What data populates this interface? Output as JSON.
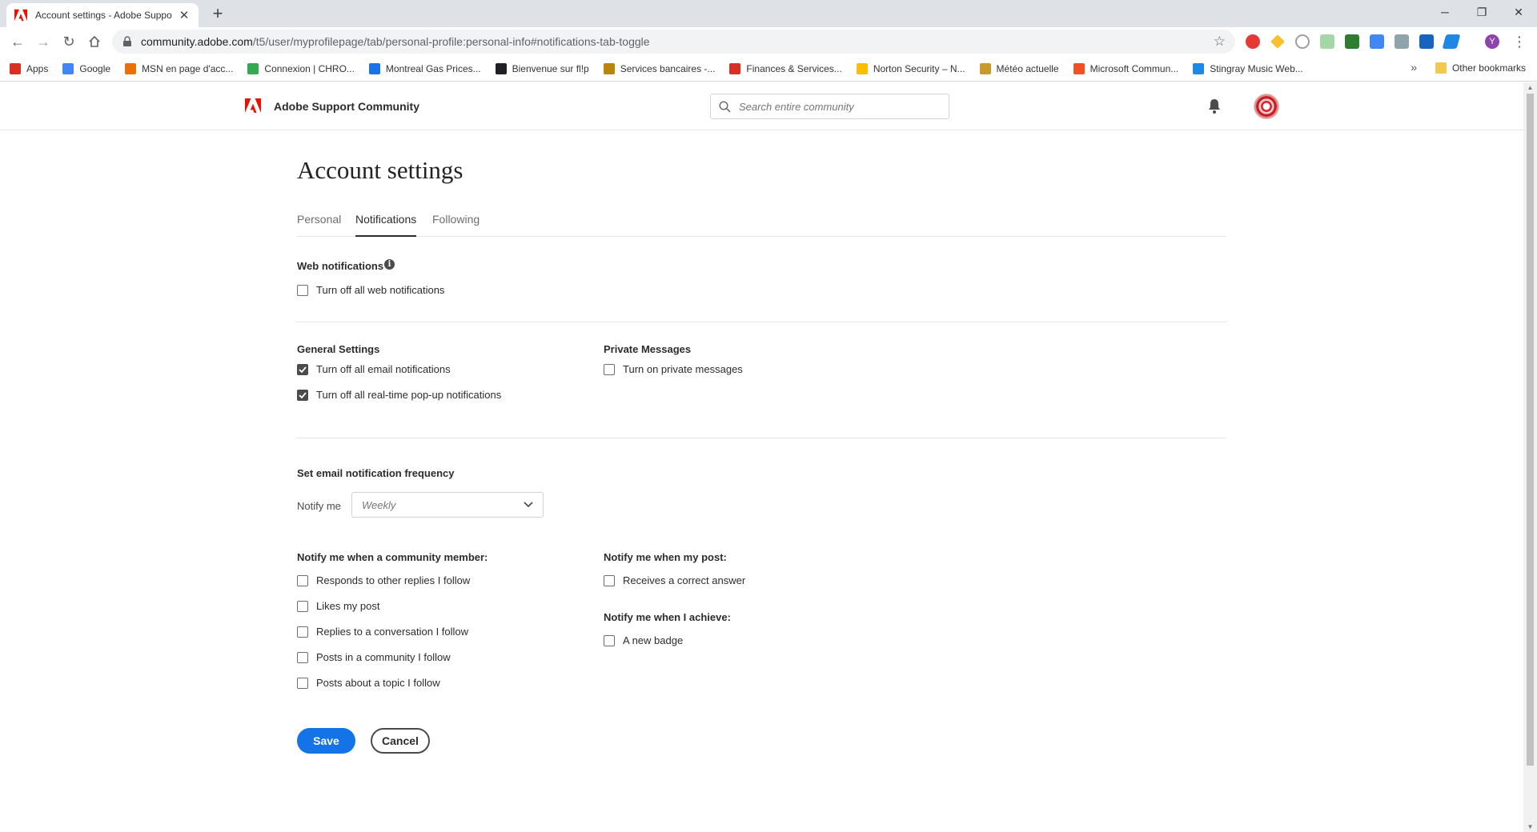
{
  "browser": {
    "tab_title": "Account settings - Adobe Suppo",
    "url_host": "community.adobe.com",
    "url_path": "/t5/user/myprofilepage/tab/personal-profile:personal-info#notifications-tab-toggle",
    "profile_initial": "Y",
    "bookmarks": [
      {
        "label": "Apps",
        "icon": "apps-grid-icon",
        "color": "#d93025"
      },
      {
        "label": "Google",
        "icon": "google-icon",
        "color": "#4285f4"
      },
      {
        "label": "MSN en page d'acc...",
        "icon": "msn-icon",
        "color": "#e8710a"
      },
      {
        "label": "Connexion | CHRO...",
        "icon": "chrono-icon",
        "color": "#34a853"
      },
      {
        "label": "Montreal Gas Prices...",
        "icon": "gasbuddy-icon",
        "color": "#1a73e8"
      },
      {
        "label": "Bienvenue sur fl!p",
        "icon": "flip-icon",
        "color": "#202124"
      },
      {
        "label": "Services bancaires -...",
        "icon": "bank-icon",
        "color": "#b8860b"
      },
      {
        "label": "Finances & Services...",
        "icon": "finance-icon",
        "color": "#d93025"
      },
      {
        "label": "Norton Security – N...",
        "icon": "norton-icon",
        "color": "#fbbc04"
      },
      {
        "label": "Météo actuelle",
        "icon": "weather-icon",
        "color": "#c99a2e"
      },
      {
        "label": "Microsoft Commun...",
        "icon": "microsoft-icon",
        "color": "#f25022"
      },
      {
        "label": "Stingray Music Web...",
        "icon": "stingray-icon",
        "color": "#1e88e5"
      }
    ],
    "other_bookmarks": "Other bookmarks"
  },
  "header": {
    "site_name": "Adobe Support Community",
    "search_placeholder": "Search entire community"
  },
  "page": {
    "title": "Account settings",
    "tabs": [
      {
        "label": "Personal",
        "active": false
      },
      {
        "label": "Notifications",
        "active": true
      },
      {
        "label": "Following",
        "active": false
      }
    ]
  },
  "web_notifications": {
    "title": "Web notifications",
    "info_glyph": "i",
    "items": [
      {
        "label": "Turn off all web notifications",
        "checked": false
      }
    ]
  },
  "general_settings": {
    "title": "General Settings",
    "items": [
      {
        "label": "Turn off all email notifications",
        "checked": true
      },
      {
        "label": "Turn off all real-time pop-up notifications",
        "checked": true
      }
    ]
  },
  "private_messages": {
    "title": "Private Messages",
    "items": [
      {
        "label": "Turn on private messages",
        "checked": false
      }
    ]
  },
  "email_frequency": {
    "title": "Set email notification frequency",
    "notify_label": "Notify me",
    "selected": "Weekly"
  },
  "community_member": {
    "title": "Notify me when a community member:",
    "items": [
      {
        "label": "Responds to other replies I follow",
        "checked": false
      },
      {
        "label": "Likes my post",
        "checked": false
      },
      {
        "label": "Replies to a conversation I follow",
        "checked": false
      },
      {
        "label": "Posts in a community I follow",
        "checked": false
      },
      {
        "label": "Posts about a topic I follow",
        "checked": false
      }
    ]
  },
  "my_post": {
    "title": "Notify me when my post:",
    "items": [
      {
        "label": "Receives a correct answer",
        "checked": false
      }
    ]
  },
  "achieve": {
    "title": "Notify me when I achieve:",
    "items": [
      {
        "label": "A new badge",
        "checked": false
      }
    ]
  },
  "actions": {
    "save": "Save",
    "cancel": "Cancel"
  },
  "colors": {
    "accent": "#1473e6",
    "adobe_red": "#eb1000",
    "checkbox_checked": "#4b4b4b"
  }
}
